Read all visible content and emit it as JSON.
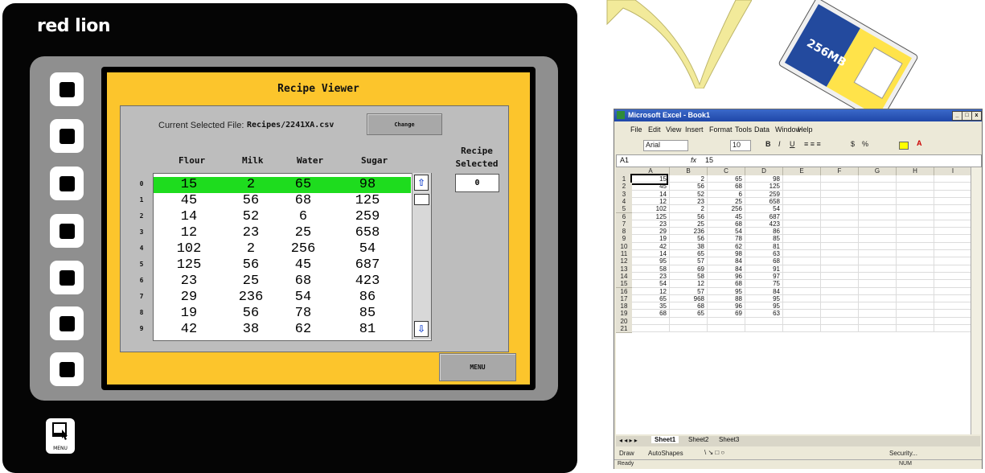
{
  "hmi": {
    "brand": "red lion",
    "title": "Recipe Viewer",
    "current_file_label": "Current Selected File:",
    "current_file_value": "Recipes/2241XA.csv",
    "change_button": "Change",
    "columns": [
      "Flour",
      "Milk",
      "Water",
      "Sugar"
    ],
    "recipe_selected_label": "Recipe Selected",
    "recipe_selected_value": "0",
    "rows": [
      {
        "idx": "0",
        "v": [
          "15",
          "2",
          "65",
          "98"
        ]
      },
      {
        "idx": "1",
        "v": [
          "45",
          "56",
          "68",
          "125"
        ]
      },
      {
        "idx": "2",
        "v": [
          "14",
          "52",
          "6",
          "259"
        ]
      },
      {
        "idx": "3",
        "v": [
          "12",
          "23",
          "25",
          "658"
        ]
      },
      {
        "idx": "4",
        "v": [
          "102",
          "2",
          "256",
          "54"
        ]
      },
      {
        "idx": "5",
        "v": [
          "125",
          "56",
          "45",
          "687"
        ]
      },
      {
        "idx": "6",
        "v": [
          "23",
          "25",
          "68",
          "423"
        ]
      },
      {
        "idx": "7",
        "v": [
          "29",
          "236",
          "54",
          "86"
        ]
      },
      {
        "idx": "8",
        "v": [
          "19",
          "56",
          "78",
          "85"
        ]
      },
      {
        "idx": "9",
        "v": [
          "42",
          "38",
          "62",
          "81"
        ]
      }
    ],
    "menu_button": "MENU",
    "menu_key_label": "MENU",
    "highlight_color": "#1edc1e",
    "panel_accent": "#fcc52c"
  },
  "excel": {
    "title": "Microsoft Excel - Book1",
    "menu": [
      "File",
      "Edit",
      "View",
      "Insert",
      "Format",
      "Tools",
      "Data",
      "Window",
      "Help"
    ],
    "font_name": "Arial",
    "font_size": "10",
    "name_box": "A1",
    "formula": "15",
    "col_headers": [
      "A",
      "B",
      "C",
      "D",
      "E",
      "F",
      "G",
      "H",
      "I"
    ],
    "rows": [
      [
        "15",
        "2",
        "65",
        "98"
      ],
      [
        "45",
        "56",
        "68",
        "125"
      ],
      [
        "14",
        "52",
        "6",
        "259"
      ],
      [
        "12",
        "23",
        "25",
        "658"
      ],
      [
        "102",
        "2",
        "256",
        "54"
      ],
      [
        "125",
        "56",
        "45",
        "687"
      ],
      [
        "23",
        "25",
        "68",
        "423"
      ],
      [
        "29",
        "236",
        "54",
        "86"
      ],
      [
        "19",
        "56",
        "78",
        "85"
      ],
      [
        "42",
        "38",
        "62",
        "81"
      ],
      [
        "14",
        "65",
        "98",
        "63"
      ],
      [
        "95",
        "57",
        "84",
        "68"
      ],
      [
        "58",
        "69",
        "84",
        "91"
      ],
      [
        "23",
        "58",
        "96",
        "97"
      ],
      [
        "54",
        "12",
        "68",
        "75"
      ],
      [
        "12",
        "57",
        "95",
        "84"
      ],
      [
        "65",
        "968",
        "88",
        "95"
      ],
      [
        "35",
        "68",
        "96",
        "95"
      ],
      [
        "68",
        "65",
        "69",
        "63"
      ]
    ],
    "row_count": 21,
    "sheets": [
      "Sheet1",
      "Sheet2",
      "Sheet3"
    ],
    "draw_label": "Draw",
    "autoshapes_label": "AutoShapes",
    "security_label": "Security...",
    "status_left": "Ready",
    "status_right": "NUM"
  },
  "cf_card": {
    "label": "256MB"
  }
}
